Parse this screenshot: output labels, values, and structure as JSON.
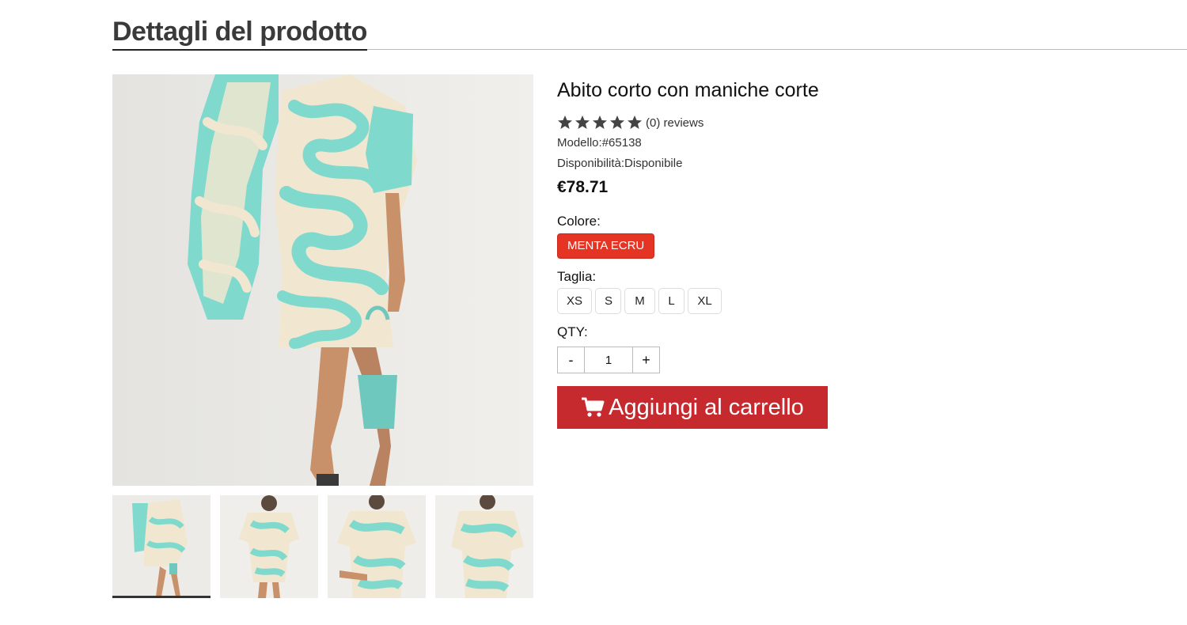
{
  "section": {
    "title": "Dettagli del prodotto"
  },
  "gallery": {
    "main_image": "product-photo-dress-swirl-print",
    "thumbnails": [
      {
        "name": "thumb-1",
        "active": true
      },
      {
        "name": "thumb-2",
        "active": false
      },
      {
        "name": "thumb-3",
        "active": false
      },
      {
        "name": "thumb-4",
        "active": false
      }
    ]
  },
  "product": {
    "title": "Abito corto con maniche corte",
    "rating": {
      "stars": 5,
      "reviews_label": "(0) reviews"
    },
    "model_line": "Modello:#65138",
    "availability_line": "Disponibilità:Disponibile",
    "price": "€78.71"
  },
  "options": {
    "color_label": "Colore:",
    "color_value": "MENTA ECRU",
    "size_label": "Taglia:",
    "sizes": [
      "XS",
      "S",
      "M",
      "L",
      "XL"
    ],
    "qty_label": "QTY:",
    "qty_minus": "-",
    "qty_value": "1",
    "qty_plus": "+"
  },
  "cart": {
    "button_label": "Aggiungi al carrello",
    "icon": "shopping-cart-icon"
  },
  "colors": {
    "accent_red": "#c62a2f",
    "chip_red": "#e53423",
    "mint": "#7fd9cd",
    "cream": "#f1e6cf"
  }
}
